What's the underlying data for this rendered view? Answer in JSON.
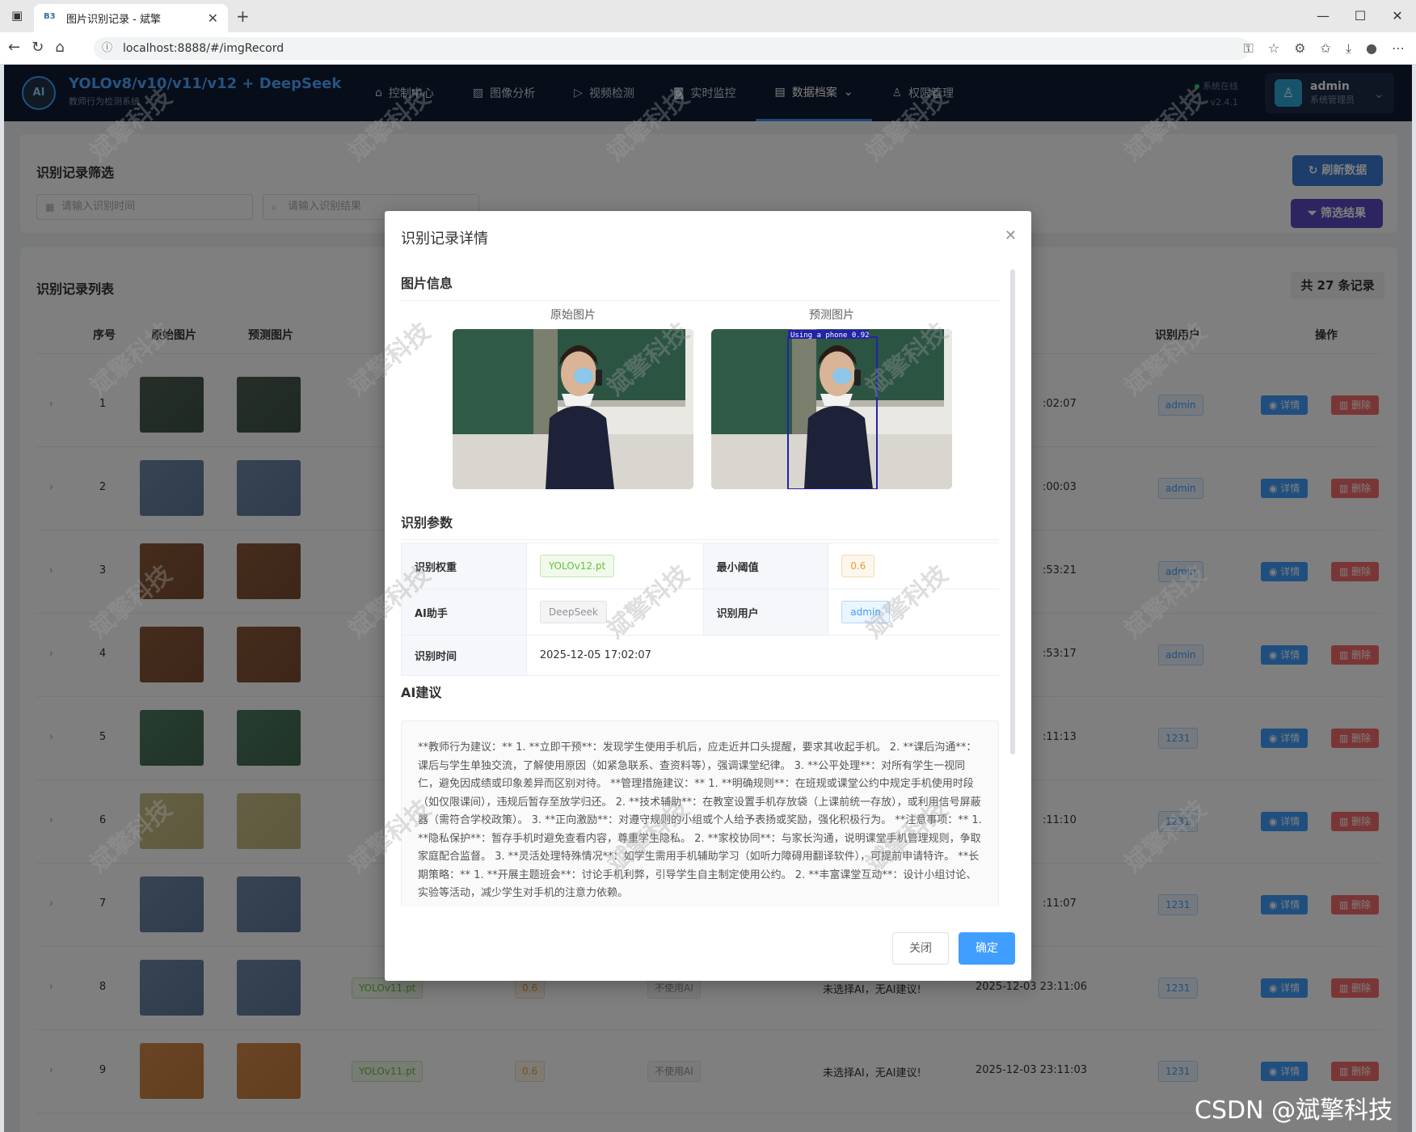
{
  "browser": {
    "tab_title": "图片识别记录 - 斌擎",
    "url": "localhost:8888/#/imgRecord"
  },
  "header": {
    "logo_text": "AI",
    "brand_title": "YOLOv8/v10/v11/v12 + DeepSeek",
    "brand_subtitle": "教师行为检测系统",
    "menu": [
      {
        "label": "控制中心",
        "icon": "home-icon"
      },
      {
        "label": "图像分析",
        "icon": "image-icon"
      },
      {
        "label": "视频检测",
        "icon": "play-icon"
      },
      {
        "label": "实时监控",
        "icon": "camera-icon"
      },
      {
        "label": "数据档案",
        "icon": "document-icon",
        "active": true
      },
      {
        "label": "权限管理",
        "icon": "user-icon"
      }
    ],
    "status": "系统在线",
    "version": "v2.4.1",
    "user_name": "admin",
    "user_role": "系统管理员"
  },
  "filter": {
    "title": "识别记录筛选",
    "time_placeholder": "请输入识别时间",
    "result_placeholder": "请输入识别结果",
    "refresh_label": "刷新数据",
    "filter_label": "筛选结果"
  },
  "list": {
    "title": "识别记录列表",
    "count": "共 27 条记录",
    "columns": [
      "序号",
      "原始图片",
      "预测图片",
      "识别用户",
      "操作"
    ],
    "detail_label": "详情",
    "delete_label": "删除",
    "rows": [
      {
        "idx": "1",
        "time": ":02:07",
        "user": "admin"
      },
      {
        "idx": "2",
        "time": ":00:03",
        "user": "admin"
      },
      {
        "idx": "3",
        "time": ":53:21",
        "user": "admin"
      },
      {
        "idx": "4",
        "time": ":53:17",
        "user": "admin"
      },
      {
        "idx": "5",
        "time": ":11:13",
        "user": "1231"
      },
      {
        "idx": "6",
        "time": ":11:10",
        "user": "1231"
      },
      {
        "idx": "7",
        "time": ":11:07",
        "user": "1231"
      },
      {
        "idx": "8",
        "weight": "YOLOv11.pt",
        "conf": "0.6",
        "ai": "不使用AI",
        "suggest": "未选择AI，无AI建议!",
        "time": "2025-12-03 23:11:06",
        "user": "1231"
      },
      {
        "idx": "9",
        "weight": "YOLOv11.pt",
        "conf": "0.6",
        "ai": "不使用AI",
        "suggest": "未选择AI，无AI建议!",
        "time": "2025-12-03 23:11:03",
        "user": "1231"
      }
    ]
  },
  "dialog": {
    "title": "识别记录详情",
    "image_section": "图片信息",
    "original_caption": "原始图片",
    "predicted_caption": "预测图片",
    "detection_label": "Using a phone 0.92",
    "params_section": "识别参数",
    "params": {
      "weight_key": "识别权重",
      "weight_val": "YOLOv12.pt",
      "conf_key": "最小阈值",
      "conf_val": "0.6",
      "ai_key": "AI助手",
      "ai_val": "DeepSeek",
      "user_key": "识别用户",
      "user_val": "admin",
      "time_key": "识别时间",
      "time_val": "2025-12-05 17:02:07"
    },
    "ai_section": "AI建议",
    "ai_text": "**教师行为建议：** 1. **立即干预**：发现学生使用手机后，应走近并口头提醒，要求其收起手机。 2. **课后沟通**：课后与学生单独交流，了解使用原因（如紧急联系、查资料等），强调课堂纪律。 3. **公平处理**：对所有学生一视同仁，避免因成绩或印象差异而区别对待。 **管理措施建议：** 1. **明确规则**：在班规或课堂公约中规定手机使用时段（如仅限课间），违规后暂存至放学归还。 2. **技术辅助**：在教室设置手机存放袋（上课前统一存放），或利用信号屏蔽器（需符合学校政策）。 3. **正向激励**：对遵守规则的小组或个人给予表扬或奖励，强化积极行为。 **注意事项：** 1. **隐私保护**：暂存手机时避免查看内容，尊重学生隐私。 2. **家校协同**：与家长沟通，说明课堂手机管理规则，争取家庭配合监督。 3. **灵活处理特殊情况**：如学生需用手机辅助学习（如听力障碍用翻译软件），可提前申请特许。 **长期策略：** 1. **开展主题班会**：讨论手机利弊，引导学生自主制定使用公约。 2. **丰富课堂互动**：设计小组讨论、实验等活动，减少学生对手机的注意力依赖。",
    "close_label": "关闭",
    "ok_label": "确定"
  },
  "watermark_text": "斌擎科技",
  "footer_mark": "CSDN @斌擎科技"
}
